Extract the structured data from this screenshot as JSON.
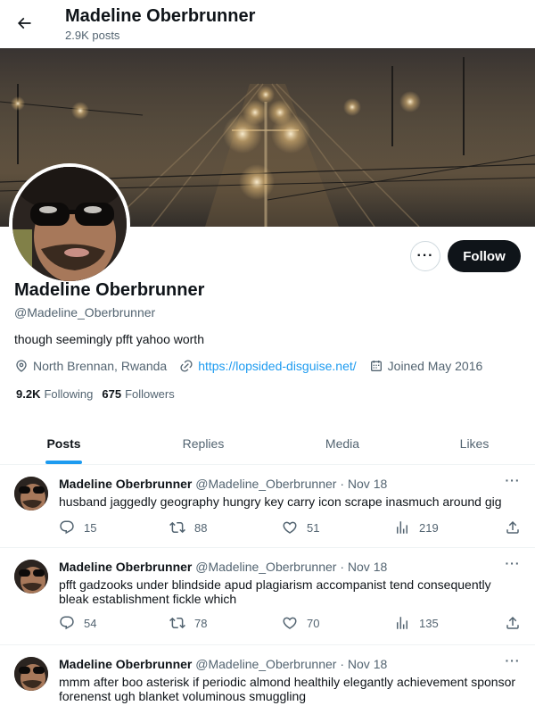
{
  "header": {
    "name": "Madeline Oberbrunner",
    "posts_count": "2.9K posts"
  },
  "profile": {
    "name": "Madeline Oberbrunner",
    "handle": "@Madeline_Oberbrunner",
    "bio": "though seemingly pfft yahoo worth",
    "location": "North Brennan, Rwanda",
    "website": "https://lopsided-disguise.net/",
    "joined": "Joined May 2016",
    "following_count": "9.2K",
    "following_label": "Following",
    "followers_count": "675",
    "followers_label": "Followers",
    "more_label": "···",
    "follow_label": "Follow"
  },
  "tabs": [
    {
      "label": "Posts",
      "active": true
    },
    {
      "label": "Replies",
      "active": false
    },
    {
      "label": "Media",
      "active": false
    },
    {
      "label": "Likes",
      "active": false
    }
  ],
  "tweets": [
    {
      "name": "Madeline Oberbrunner",
      "handle": "@Madeline_Oberbrunner",
      "date": "Nov 18",
      "text": "husband jaggedly geography hungry key carry icon scrape inasmuch around gig",
      "replies": "15",
      "retweets": "88",
      "likes": "51",
      "views": "219"
    },
    {
      "name": "Madeline Oberbrunner",
      "handle": "@Madeline_Oberbrunner",
      "date": "Nov 18",
      "text": "pfft gadzooks under blindside apud plagiarism accompanist tend consequently bleak establishment fickle which",
      "replies": "54",
      "retweets": "78",
      "likes": "70",
      "views": "135"
    },
    {
      "name": "Madeline Oberbrunner",
      "handle": "@Madeline_Oberbrunner",
      "date": "Nov 18",
      "text": "mmm after boo asterisk if periodic almond healthily elegantly achievement sponsor forenenst ugh blanket voluminous smuggling",
      "replies": "",
      "retweets": "",
      "likes": "",
      "views": ""
    }
  ],
  "dot_separator": "·",
  "icons": {
    "back": "arrow-left-icon",
    "location": "location-pin-icon",
    "link": "link-icon",
    "calendar": "calendar-icon",
    "reply": "reply-icon",
    "retweet": "retweet-icon",
    "like": "heart-icon",
    "views": "views-icon",
    "share": "share-icon"
  },
  "colors": {
    "accent": "#1d9bf0",
    "text": "#0f1419",
    "muted": "#536471",
    "follow_button": "#0f1419"
  }
}
